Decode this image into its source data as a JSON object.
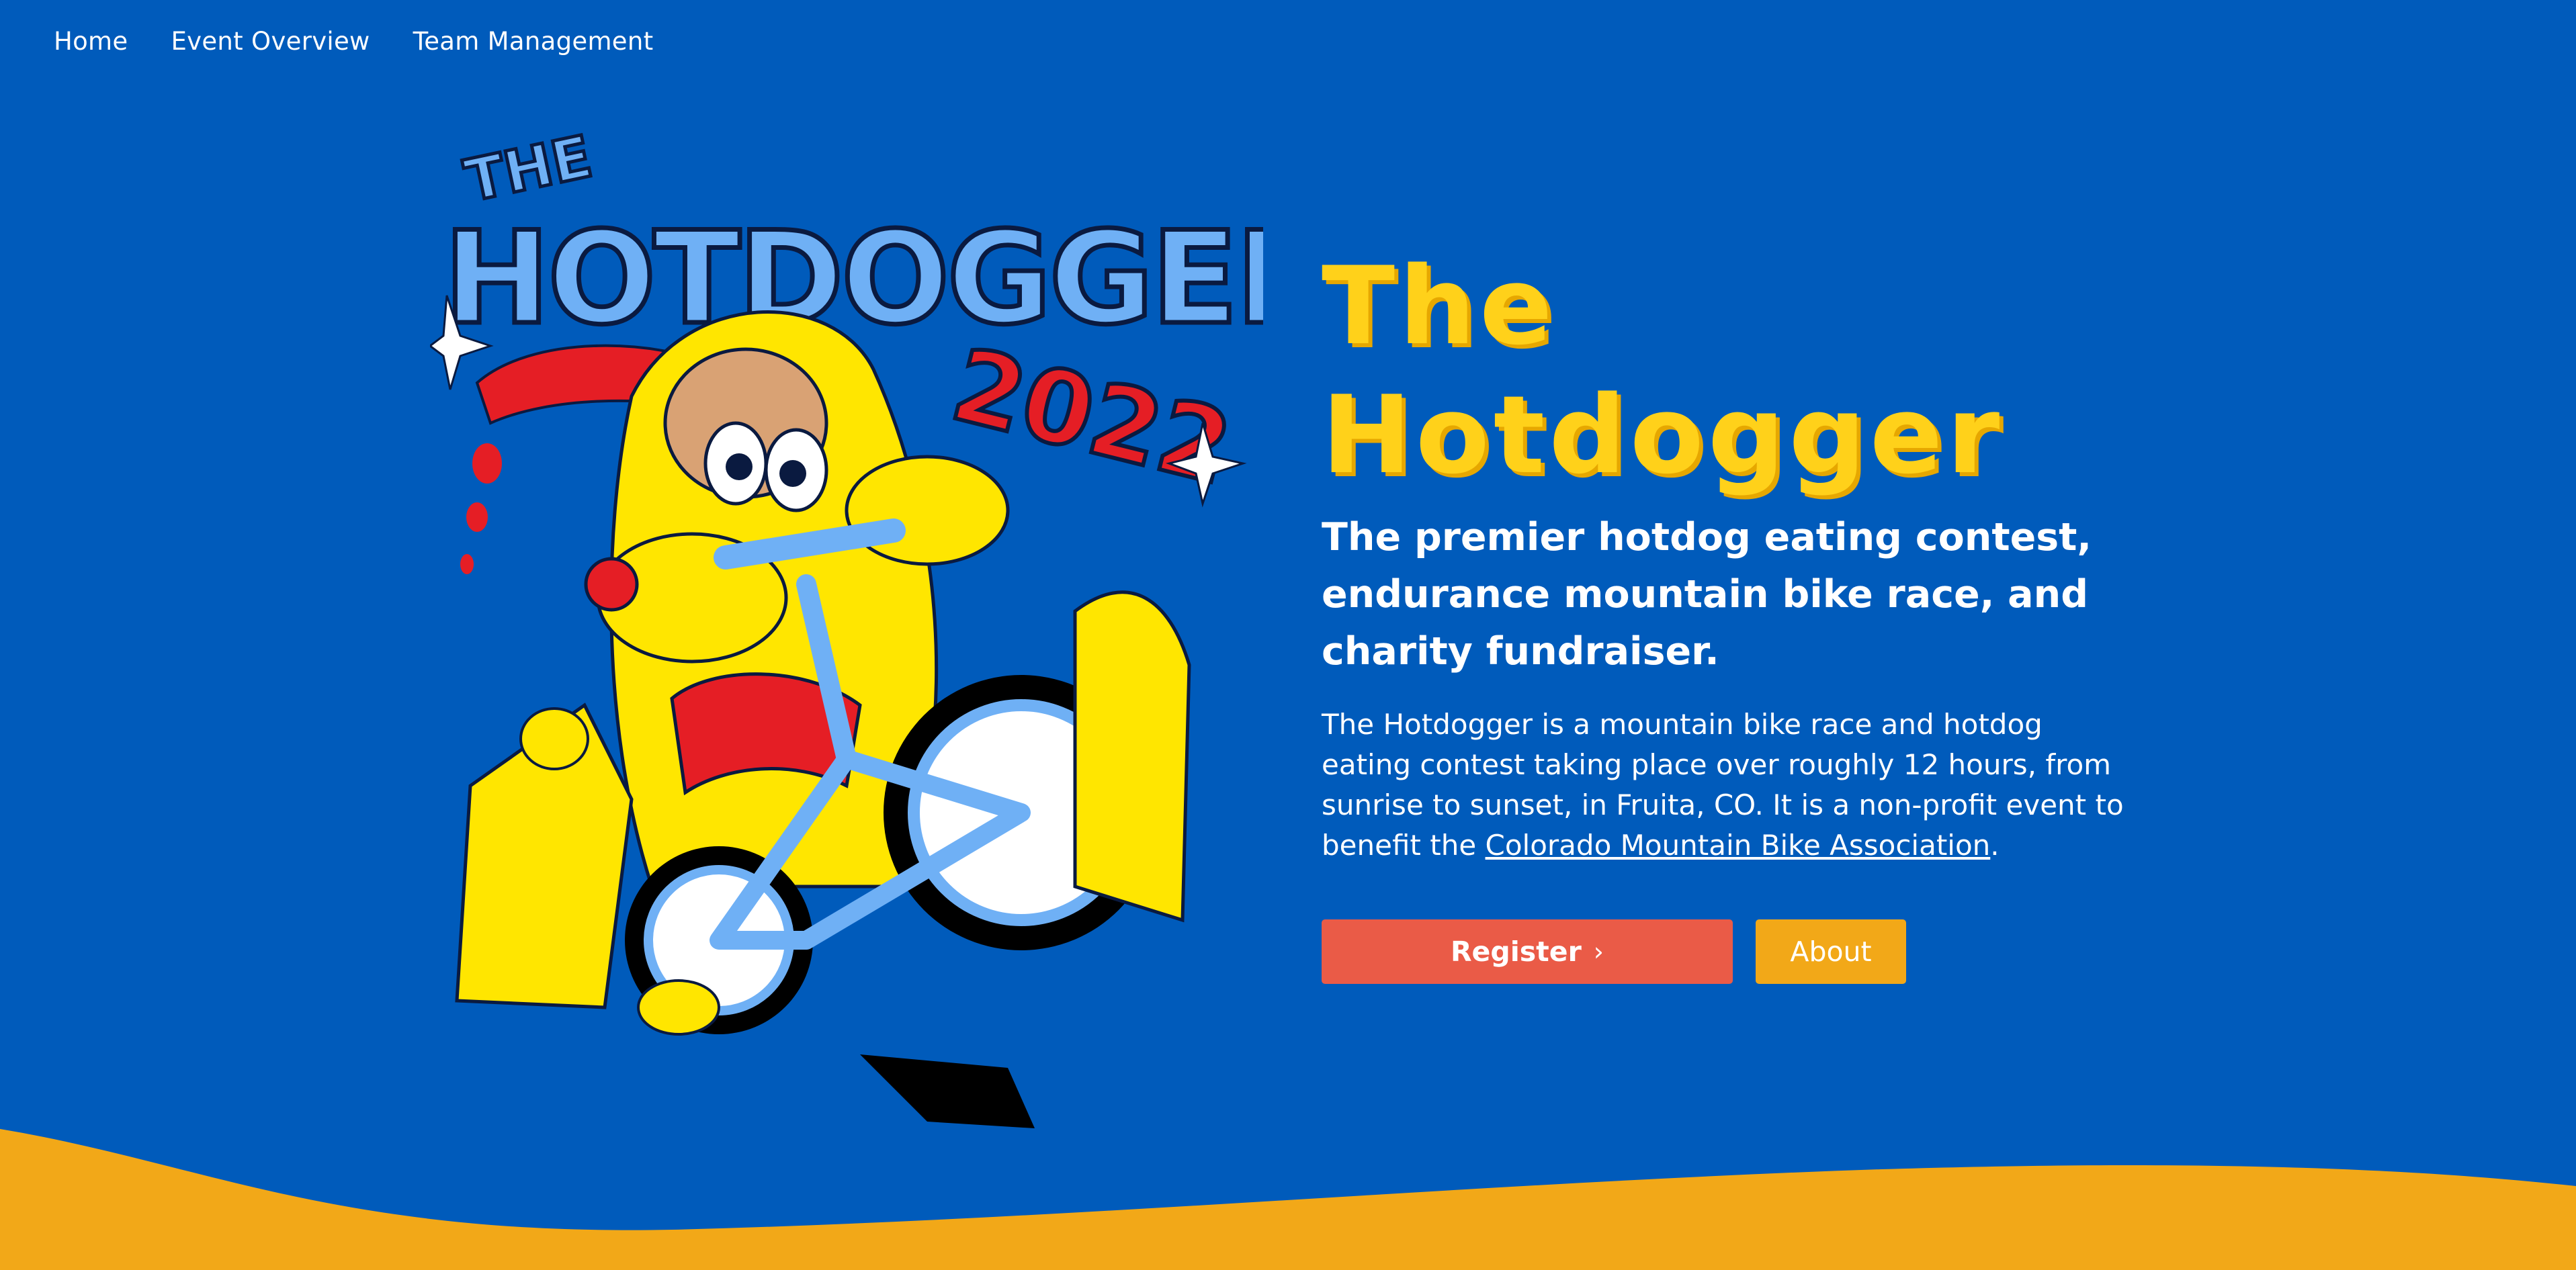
{
  "nav": {
    "items": [
      {
        "label": "Home"
      },
      {
        "label": "Event Overview"
      },
      {
        "label": "Team Management"
      }
    ]
  },
  "hero": {
    "title_line1": "The",
    "title_line2": "Hotdogger",
    "tagline": "The premier hotdog eating contest, endurance mountain bike race, and charity fundraiser.",
    "description": "The Hotdogger is a mountain bike race and hotdog eating contest taking place over roughly 12 hours, from sunrise to sunset, in Fruita, CO. It is a non-profit event to benefit the ",
    "link_text": "Colorado Mountain Bike Association",
    "description_end": "."
  },
  "buttons": {
    "register_label": "Register",
    "register_icon": "chevron-right-icon",
    "about_label": "About"
  },
  "illustration": {
    "logo_text_top": "THE",
    "logo_text_main": "HOTDOGGER",
    "logo_year": "2022"
  },
  "colors": {
    "background": "#005bbb",
    "title_yellow": "#ffd11a",
    "register_red": "#ea5b47",
    "about_orange": "#f2a818",
    "wave_orange": "#f2a818",
    "logo_blue": "#6fb0f5",
    "logo_red": "#e51e25"
  }
}
